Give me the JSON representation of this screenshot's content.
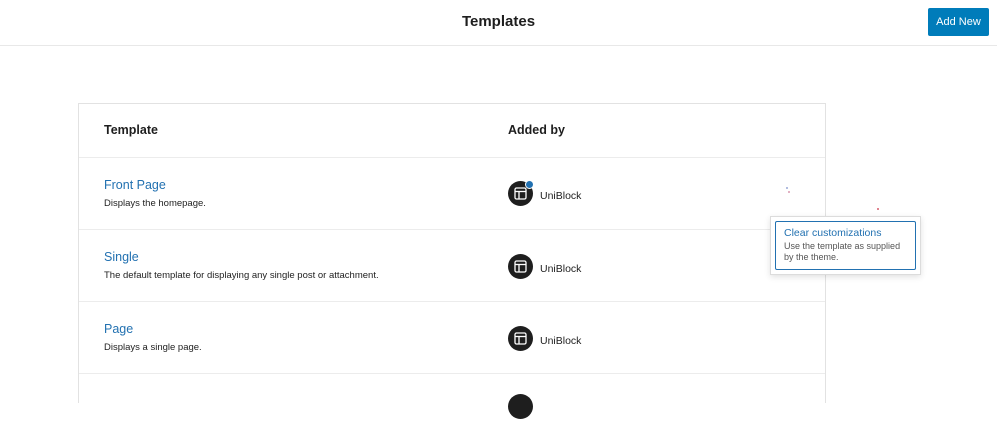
{
  "header": {
    "title": "Templates",
    "add_new_label": "Add New"
  },
  "table": {
    "columns": [
      "Template",
      "Added by"
    ],
    "rows": [
      {
        "title": "Front Page",
        "description": "Displays the homepage.",
        "author": "UniBlock",
        "customized": true
      },
      {
        "title": "Single",
        "description": "The default template for displaying any single post or attachment.",
        "author": "UniBlock",
        "customized": false
      },
      {
        "title": "Page",
        "description": "Displays a single page.",
        "author": "UniBlock",
        "customized": false
      }
    ]
  },
  "popover": {
    "action_label": "Clear customizations",
    "action_help": "Use the template as supplied by the theme."
  },
  "colors": {
    "accent": "#007cba",
    "link": "#2271b1",
    "text": "#1e1e1e"
  }
}
